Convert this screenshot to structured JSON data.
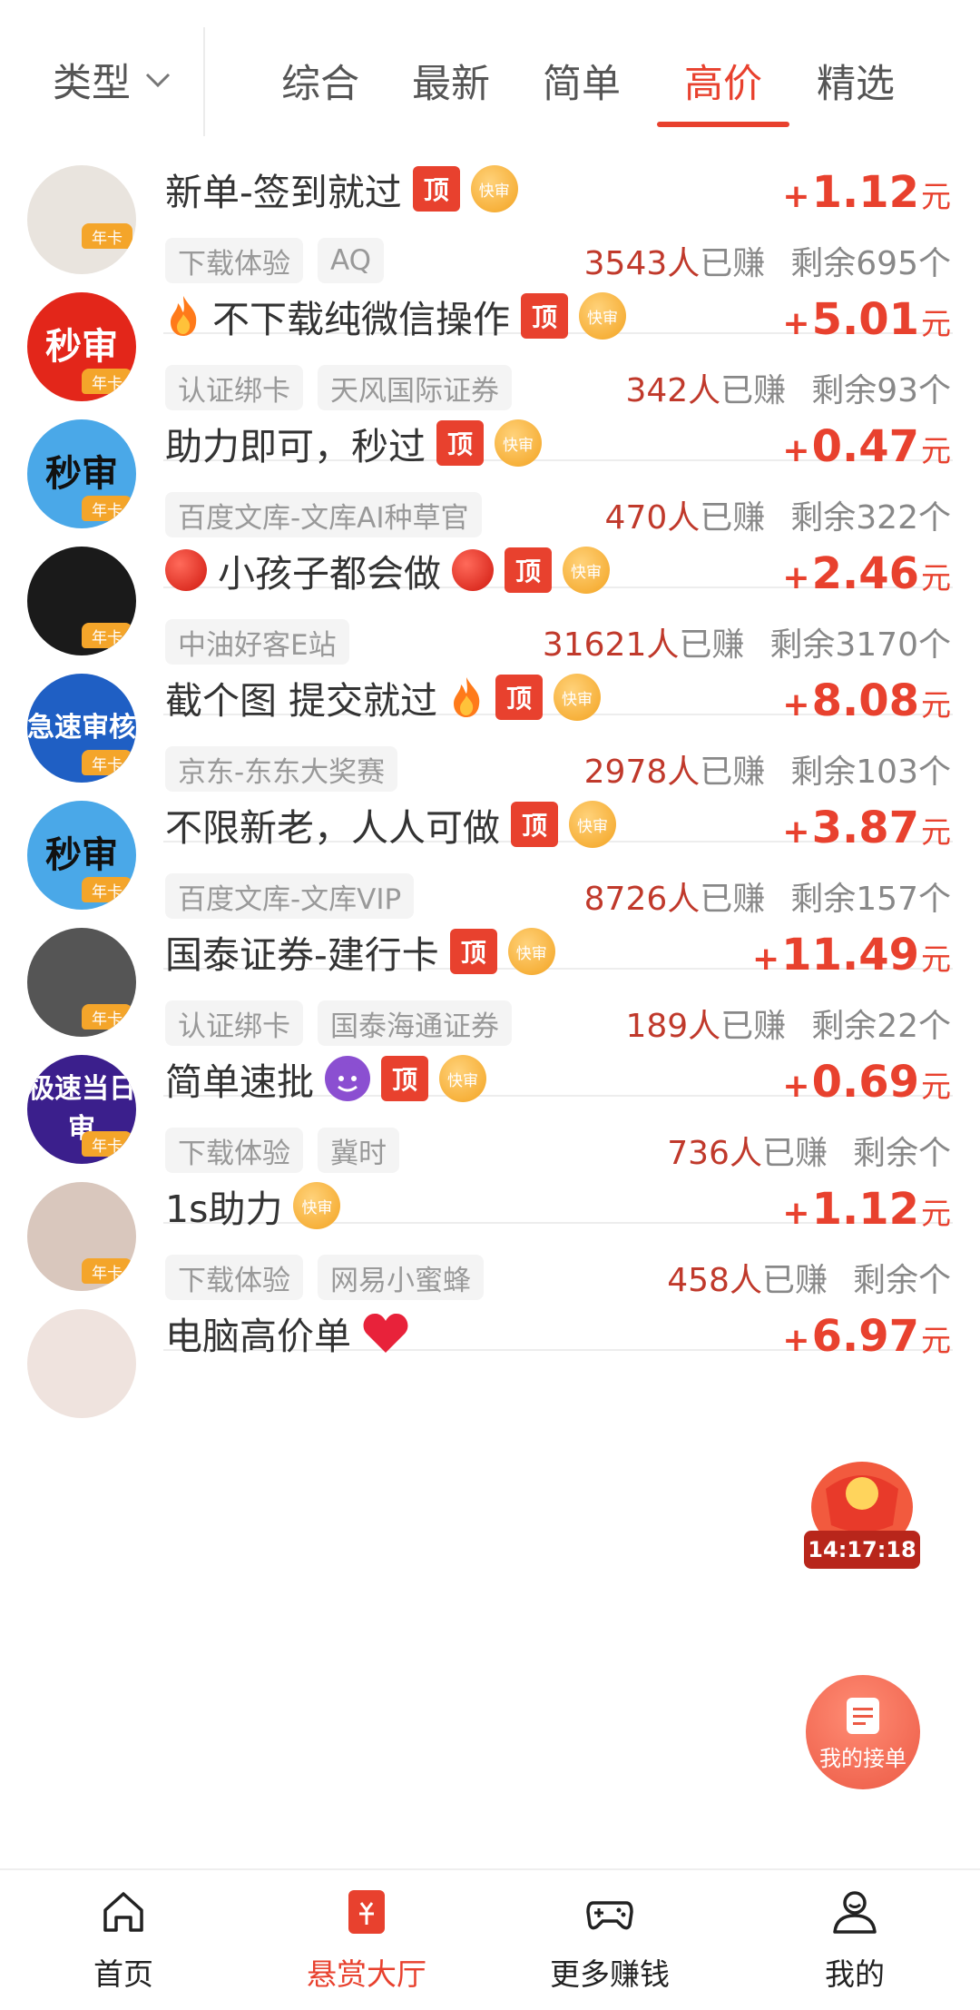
{
  "top_filter": {
    "label": "类型"
  },
  "tabs": [
    "综合",
    "最新",
    "简单",
    "高价",
    "精选"
  ],
  "active_tab": "高价",
  "colors": {
    "accent": "#e8412e",
    "earned": "#c0392b",
    "badge_gold": "#f3a321"
  },
  "tags": {
    "top": "顶",
    "fast": "快审",
    "annual": "年卡"
  },
  "tasks": [
    {
      "title": "新单-签到就过",
      "icons": [],
      "chips": [
        "下载体验",
        "AQ"
      ],
      "plus": "+",
      "price": "1.12",
      "unit": "元",
      "earned_count": "3543人",
      "earned_suffix": "已赚",
      "remain": "剩余695个",
      "has_top": true,
      "avatar_text": "",
      "avatar_color": "#e9e4de"
    },
    {
      "title": "不下载纯微信操作",
      "icons": [
        "fire"
      ],
      "chips": [
        "认证绑卡",
        "天风国际证券"
      ],
      "plus": "+",
      "price": "5.01",
      "unit": "元",
      "earned_count": "342人",
      "earned_suffix": "已赚",
      "remain": "剩余93个",
      "has_top": true,
      "avatar_text": "秒审",
      "avatar_color": "#e3261a"
    },
    {
      "title": "助力即可，秒过",
      "icons": [],
      "chips": [
        "百度文库-文库AI种草官"
      ],
      "plus": "+",
      "price": "0.47",
      "unit": "元",
      "earned_count": "470人",
      "earned_suffix": "已赚",
      "remain": "剩余322个",
      "has_top": true,
      "avatar_text": "秒审",
      "avatar_color": "#4aa8e8"
    },
    {
      "title": "小孩子都会做",
      "icons": [
        "red-dot"
      ],
      "chips": [
        "中油好客E站"
      ],
      "plus": "+",
      "price": "2.46",
      "unit": "元",
      "earned_count": "31621人",
      "earned_suffix": "已赚",
      "remain": "剩余3170个",
      "has_top": true,
      "avatar_text": "",
      "avatar_color": "#1a1a1a"
    },
    {
      "title": "截个图 提交就过",
      "icons": [
        "fire-after"
      ],
      "chips": [
        "京东-东东大奖赛"
      ],
      "plus": "+",
      "price": "8.08",
      "unit": "元",
      "earned_count": "2978人",
      "earned_suffix": "已赚",
      "remain": "剩余103个",
      "has_top": true,
      "avatar_text": "急速审核",
      "avatar_color": "#1f5fc4"
    },
    {
      "title": "不限新老，人人可做",
      "icons": [],
      "chips": [
        "百度文库-文库VIP"
      ],
      "plus": "+",
      "price": "3.87",
      "unit": "元",
      "earned_count": "8726人",
      "earned_suffix": "已赚",
      "remain": "剩余157个",
      "has_top": true,
      "avatar_text": "秒审",
      "avatar_color": "#4aa8e8"
    },
    {
      "title": "国泰证券-建行卡",
      "icons": [],
      "chips": [
        "认证绑卡",
        "国泰海通证券"
      ],
      "plus": "+",
      "price": "11.49",
      "unit": "元",
      "earned_count": "189人",
      "earned_suffix": "已赚",
      "remain": "剩余22个",
      "has_top": true,
      "avatar_text": "",
      "avatar_color": "#555555"
    },
    {
      "title": "简单速批",
      "icons": [
        "devil"
      ],
      "chips": [
        "下载体验",
        "冀时"
      ],
      "plus": "+",
      "price": "0.69",
      "unit": "元",
      "earned_count": "736人",
      "earned_suffix": "已赚",
      "remain": "剩余个",
      "has_top": true,
      "avatar_text": "极速当日审",
      "avatar_color": "#3b1f8c"
    },
    {
      "title": "1s助力",
      "icons": [],
      "chips": [
        "下载体验",
        "网易小蜜蜂"
      ],
      "plus": "+",
      "price": "1.12",
      "unit": "元",
      "earned_count": "458人",
      "earned_suffix": "已赚",
      "remain": "剩余个",
      "has_top": false,
      "avatar_text": "",
      "avatar_color": "#d9c7bd"
    },
    {
      "title": "电脑高价单",
      "icons": [
        "heart"
      ],
      "chips": [],
      "plus": "+",
      "price": "6.97",
      "unit": "元",
      "earned_count": "",
      "earned_suffix": "",
      "remain": "",
      "has_top": false,
      "no_fast": true,
      "avatar_text": "",
      "avatar_color": "#efe3de"
    }
  ],
  "floating": {
    "timer": "14:17:18",
    "my_orders": "我的接单"
  },
  "bottom_nav": [
    {
      "label": "首页",
      "icon": "home-icon",
      "active": false
    },
    {
      "label": "悬赏大厅",
      "icon": "bounty-hall-icon",
      "active": true
    },
    {
      "label": "更多赚钱",
      "icon": "gamepad-icon",
      "active": false
    },
    {
      "label": "我的",
      "icon": "profile-icon",
      "active": false
    }
  ]
}
